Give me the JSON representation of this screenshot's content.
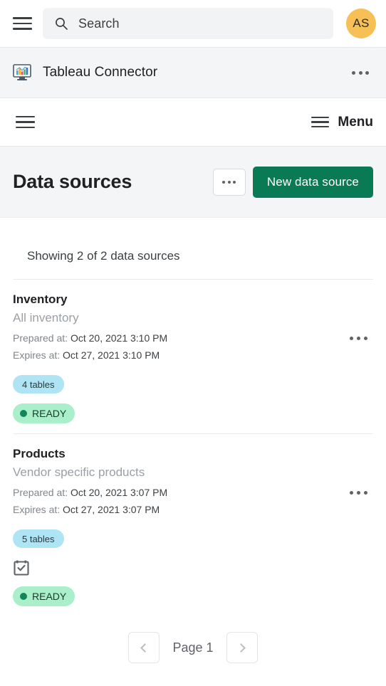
{
  "topbar": {
    "menu_icon": "hamburger-icon",
    "search": {
      "placeholder": "Search",
      "icon": "search-icon"
    },
    "avatar": {
      "initials": "AS",
      "color": "#f6c056"
    }
  },
  "appstrip": {
    "icon": "tableau-connector-icon",
    "name": "Tableau Connector",
    "overflow_icon": "kebab-icon"
  },
  "menubar": {
    "left_icon": "hamburger-icon",
    "menu_label": "Menu",
    "menu_icon": "hamburger-icon"
  },
  "pagehead": {
    "title": "Data sources",
    "overflow_label": "...",
    "primary_button": "New data source",
    "primary_color": "#0a7a54"
  },
  "list": {
    "showing": "Showing 2 of 2 data sources",
    "labels": {
      "prepared": "Prepared at:",
      "expires": "Expires at:"
    },
    "items": [
      {
        "title": "Inventory",
        "subtitle": "All inventory",
        "prepared_at": "Oct 20, 2021 3:10 PM",
        "expires_at": "Oct 27, 2021 3:10 PM",
        "tables": "4 tables",
        "status": "READY",
        "status_color": "#12855a",
        "has_schedule_icon": false
      },
      {
        "title": "Products",
        "subtitle": "Vendor specific products",
        "prepared_at": "Oct 20, 2021 3:07 PM",
        "expires_at": "Oct 27, 2021 3:07 PM",
        "tables": "5 tables",
        "status": "READY",
        "status_color": "#12855a",
        "has_schedule_icon": true,
        "schedule_icon": "calendar-check-icon"
      }
    ]
  },
  "pagination": {
    "prev_icon": "chevron-left-icon",
    "page_label": "Page 1",
    "next_icon": "chevron-right-icon"
  }
}
